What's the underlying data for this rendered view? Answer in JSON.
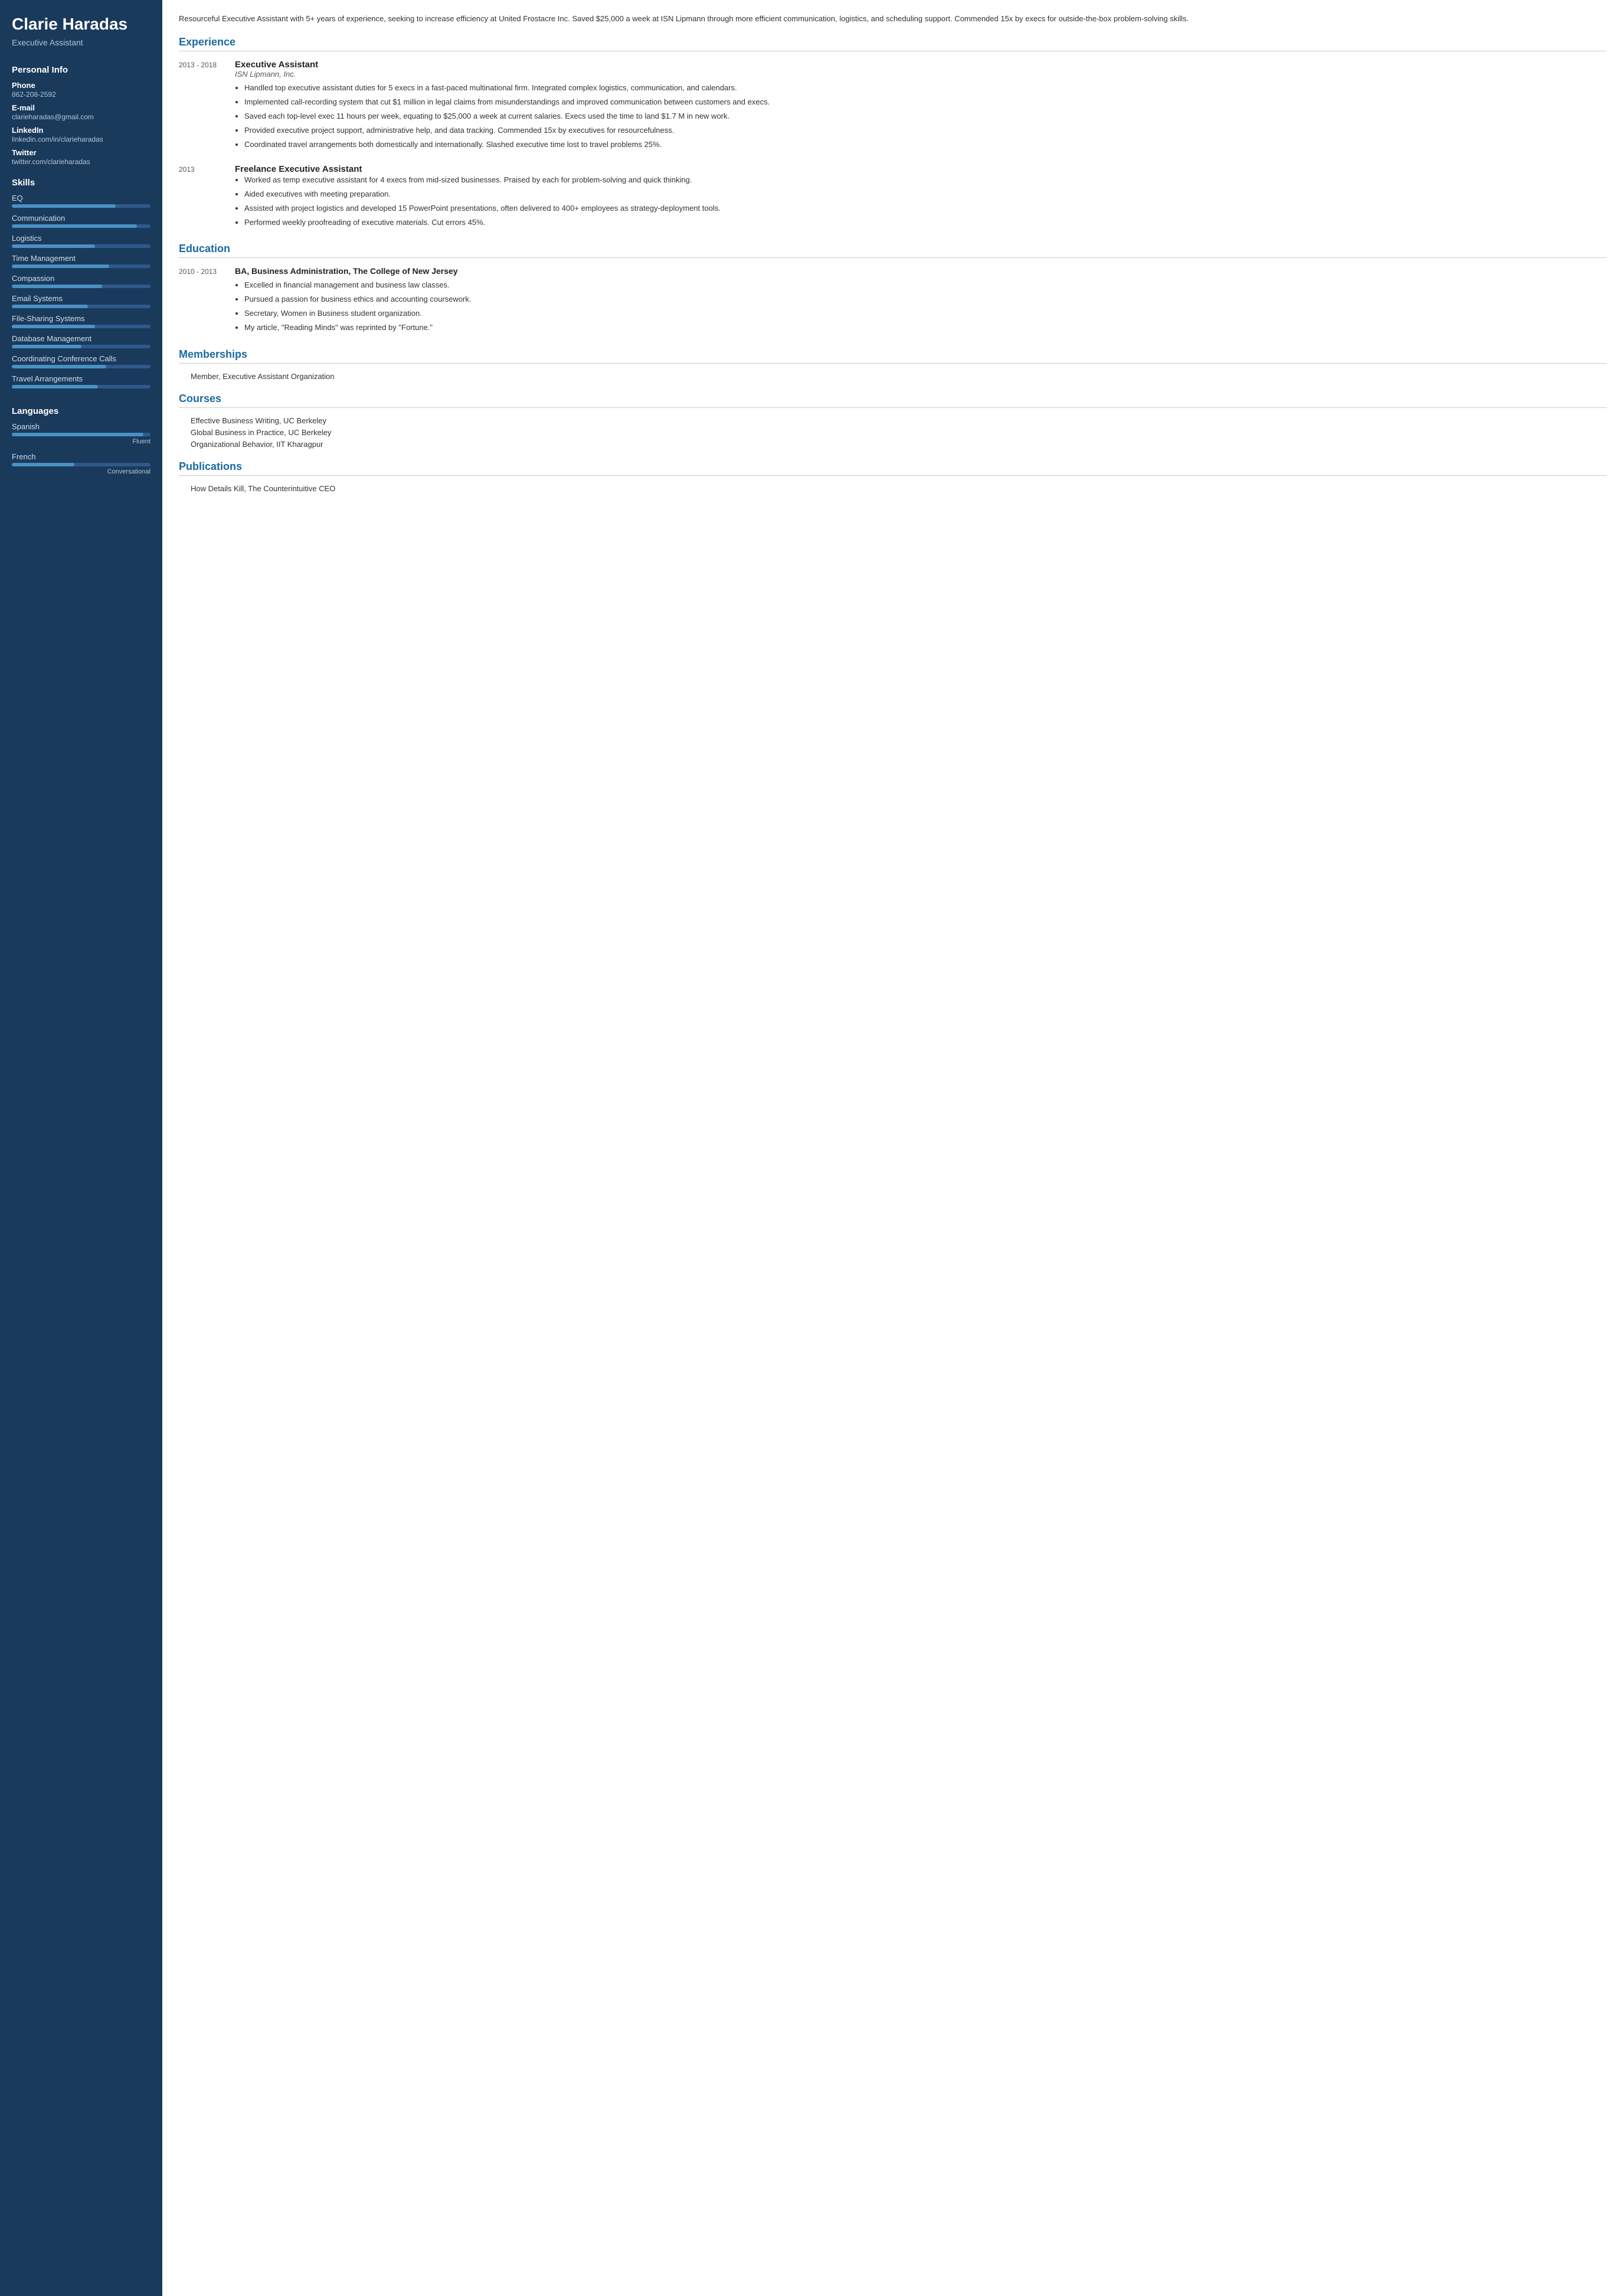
{
  "sidebar": {
    "name": "Clarie Haradas",
    "title": "Executive Assistant",
    "personal_info": {
      "section_title": "Personal Info",
      "phone_label": "Phone",
      "phone": "862-208-2592",
      "email_label": "E-mail",
      "email": "clarieharadas@gmail.com",
      "linkedin_label": "LinkedIn",
      "linkedin": "linkedin.com/in/clarieharadas",
      "twitter_label": "Twitter",
      "twitter": "twitter.com/clarieharadas"
    },
    "skills": {
      "section_title": "Skills",
      "items": [
        {
          "name": "EQ",
          "pct": 75
        },
        {
          "name": "Communication",
          "pct": 90
        },
        {
          "name": "Logistics",
          "pct": 60
        },
        {
          "name": "Time Management",
          "pct": 70
        },
        {
          "name": "Compassion",
          "pct": 65
        },
        {
          "name": "Email Systems",
          "pct": 55
        },
        {
          "name": "File-Sharing Systems",
          "pct": 60
        },
        {
          "name": "Database Management",
          "pct": 50
        },
        {
          "name": "Coordinating Conference Calls",
          "pct": 68
        },
        {
          "name": "Travel Arrangements",
          "pct": 62
        }
      ]
    },
    "languages": {
      "section_title": "Languages",
      "items": [
        {
          "name": "Spanish",
          "pct": 95,
          "level": "Fluent"
        },
        {
          "name": "French",
          "pct": 45,
          "level": "Conversational"
        }
      ]
    }
  },
  "main": {
    "summary": "Resourceful Executive Assistant with 5+ years of experience, seeking to increase efficiency at United Frostacre Inc. Saved $25,000 a week at ISN Lipmann through more efficient communication, logistics, and scheduling support. Commended 15x by execs for outside-the-box problem-solving skills.",
    "experience": {
      "section_title": "Experience",
      "entries": [
        {
          "dates": "2013 - 2018",
          "title": "Executive Assistant",
          "company": "ISN Lipmann, Inc.",
          "bullets": [
            "Handled top executive assistant duties for 5 execs in a fast-paced multinational firm. Integrated complex logistics, communication, and calendars.",
            "Implemented call-recording system that cut $1 million in legal claims from misunderstandings and improved communication between customers and execs.",
            "Saved each top-level exec 11 hours per week, equating to $25,000 a week at current salaries. Execs used the time to land $1.7 M in new work.",
            "Provided executive project support, administrative help, and data tracking. Commended 15x by executives for resourcefulness.",
            "Coordinated travel arrangements both domestically and internationally. Slashed executive time lost to travel problems 25%."
          ]
        },
        {
          "dates": "2013",
          "title": "Freelance Executive Assistant",
          "company": "",
          "bullets": [
            "Worked as temp executive assistant for 4 execs from mid-sized businesses. Praised by each for problem-solving and quick thinking.",
            "Aided executives with meeting preparation.",
            "Assisted with project logistics and developed 15 PowerPoint presentations, often delivered to 400+ employees as strategy-deployment tools.",
            "Performed weekly proofreading of executive materials. Cut errors 45%."
          ]
        }
      ]
    },
    "education": {
      "section_title": "Education",
      "entries": [
        {
          "dates": "2010 - 2013",
          "title": "BA, Business Administration, The College of New Jersey",
          "bullets": [
            "Excelled in financial management and business law classes.",
            "Pursued a passion for business ethics and accounting coursework.",
            "Secretary, Women in Business student organization.",
            "My article, \"Reading Minds\" was reprinted by \"Fortune.\""
          ]
        }
      ]
    },
    "memberships": {
      "section_title": "Memberships",
      "items": [
        "Member, Executive Assistant Organization"
      ]
    },
    "courses": {
      "section_title": "Courses",
      "items": [
        "Effective Business Writing, UC Berkeley",
        "Global Business in Practice, UC Berkeley",
        "Organizational Behavior, IIT Kharagpur"
      ]
    },
    "publications": {
      "section_title": "Publications",
      "items": [
        "How Details Kill, The Counterintuitive CEO"
      ]
    }
  }
}
